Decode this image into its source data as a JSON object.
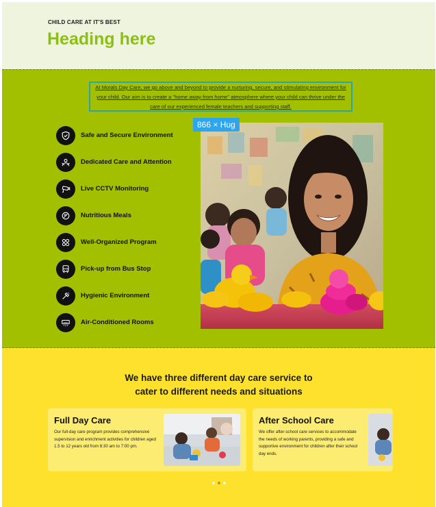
{
  "hero": {
    "eyebrow": "CHILD CARE AT IT'S BEST",
    "heading": "Heading here"
  },
  "intro": {
    "text": "At Morals Day Care, we go above and beyond to provide a nurturing, secure, and stimulating environment for your child. Our aim is to create a \"home away from home\" atmosphere where your child can thrive under the care of our experienced female teachers and supporting staff."
  },
  "selection_badge": "866 × Hug",
  "features": [
    {
      "label": "Safe and Secure Environment",
      "icon": "shield-icon"
    },
    {
      "label": "Dedicated Care and Attention",
      "icon": "care-hands-icon"
    },
    {
      "label": "Live CCTV Monitoring",
      "icon": "cctv-camera-icon"
    },
    {
      "label": "Nutritious Meals",
      "icon": "meal-icon"
    },
    {
      "label": "Well-Organized Program",
      "icon": "program-grid-icon"
    },
    {
      "label": "Pick-up from Bus Stop",
      "icon": "bus-icon"
    },
    {
      "label": "Hygienic Environment",
      "icon": "hygiene-icon"
    },
    {
      "label": "Air-Conditioned Rooms",
      "icon": "air-conditioner-icon"
    }
  ],
  "services": {
    "title_line1": "We have three different day care service to",
    "title_line2": "cater to different needs and situations",
    "cards": [
      {
        "title": "Full Day Care",
        "description": "Our full-day care program provides comprehensive supervision and enrichment activities for children aged 1.5 to 12 years old from 8:30 am to 7:00 pm."
      },
      {
        "title": "After School Care",
        "description": "We offer after-school care services to accommodate the needs of working parents, providing a safe and supportive environment for children after their school day ends."
      }
    ]
  },
  "colors": {
    "green": "#a3c000",
    "yellow": "#fde12d",
    "heading_green": "#8cbf14",
    "badge_blue": "#2fa5ee"
  }
}
